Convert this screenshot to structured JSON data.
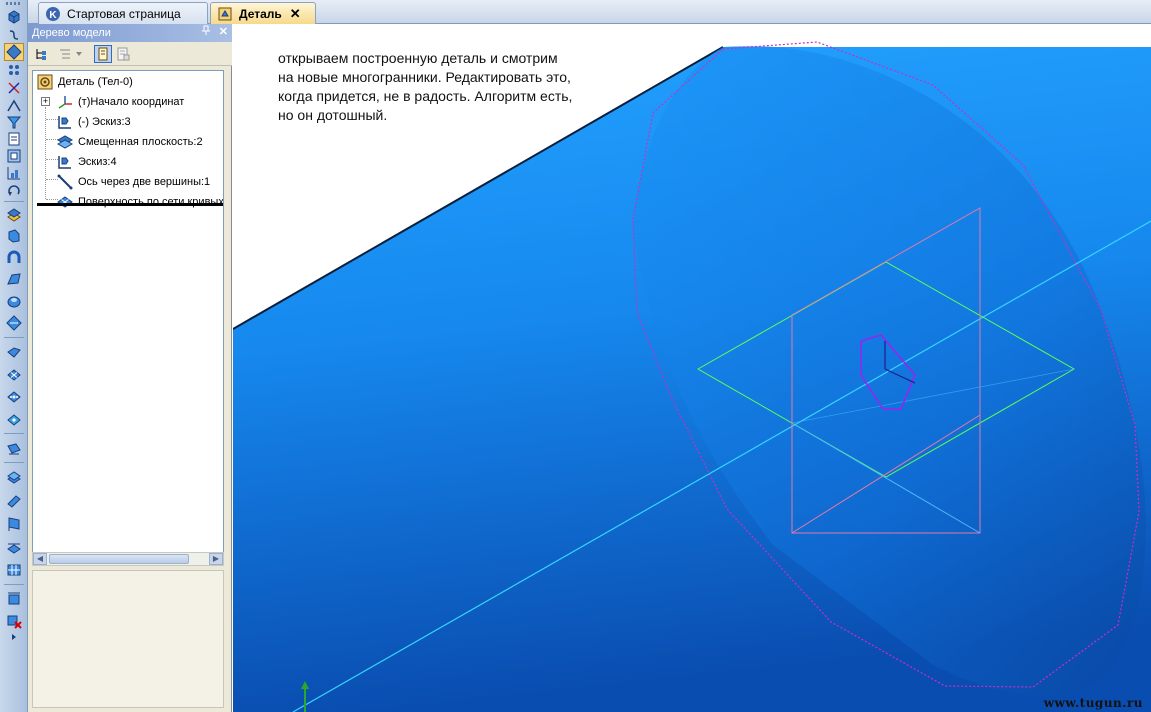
{
  "tabs": [
    {
      "label": "Стартовая страница",
      "active": false
    },
    {
      "label": "Деталь",
      "active": true,
      "close": "✕"
    }
  ],
  "tree_panel": {
    "title": "Дерево модели",
    "pin": "ᵖ",
    "close": "✕",
    "items": [
      {
        "label": "Деталь (Тел-0)",
        "icon": "part-icon"
      },
      {
        "label": "(т)Начало координат",
        "icon": "origin-axes-icon"
      },
      {
        "label": "(-) Эскиз:3",
        "icon": "sketch-icon"
      },
      {
        "label": "Смещенная плоскость:2",
        "icon": "offset-plane-icon"
      },
      {
        "label": "Эскиз:4",
        "icon": "sketch-icon"
      },
      {
        "label": "Ось через две вершины:1",
        "icon": "axis-icon"
      },
      {
        "label": "Поверхность по сети кривых",
        "icon": "mesh-surface-icon"
      }
    ],
    "expander": "+"
  },
  "note": {
    "lines": [
      "открываем построенную деталь и смотрим",
      "на новые многогранники. Редактировать это,",
      "когда придется, не в радость. Алгоритм есть,",
      "но он дотошный."
    ]
  },
  "watermark": "www.tugun.ru",
  "colors": {
    "solid_blue_light": "#1a8ff0",
    "solid_blue_dark": "#0a4fae",
    "polygon_outline": "#cc2cc6",
    "axis_line": "#33d6ff",
    "plane_green": "#5aff5a",
    "plane_pink": "#e07aa8"
  }
}
